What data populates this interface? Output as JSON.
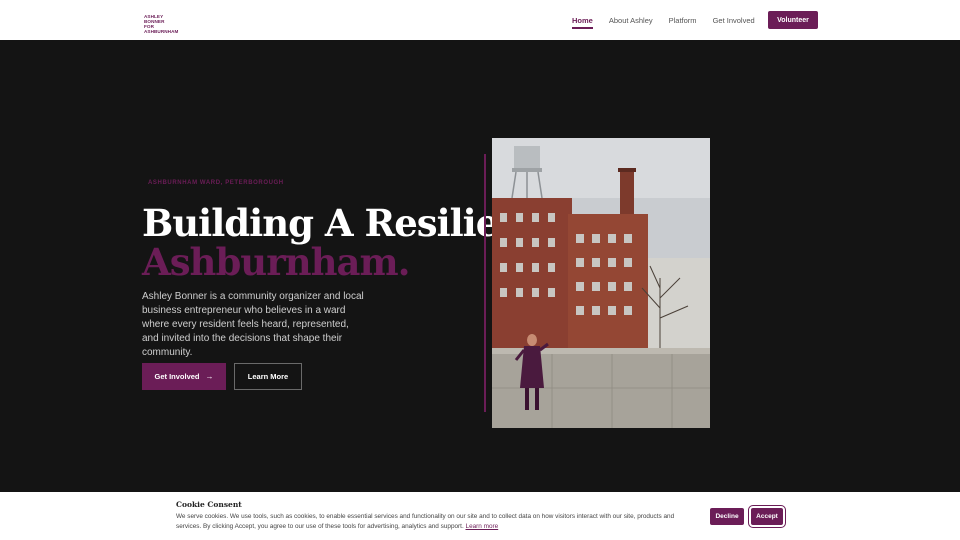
{
  "header": {
    "logo_line1": "ASHLEY BONNER",
    "logo_line2": "FOR ASHBURNHAM",
    "nav": [
      {
        "label": "Home",
        "active": true
      },
      {
        "label": "About Ashley"
      },
      {
        "label": "Platform"
      },
      {
        "label": "Get Involved"
      }
    ],
    "cta_label": "Volunteer"
  },
  "hero": {
    "eyebrow": "ASHBURNHAM WARD, PETERBOROUGH",
    "headline": "Building A Resilient",
    "headline_accent": "Ashburnham.",
    "lede": "Ashley Bonner is a community organizer and local business entrepreneur who believes in a ward where every resident feels heard, represented, and invited into the decisions that shape their community.",
    "primary_button": "Get Involved",
    "primary_button_icon": "arrow-right-icon",
    "secondary_button": "Learn More"
  },
  "cookie": {
    "title": "Cookie Consent",
    "text": "We serve cookies. We use tools, such as cookies, to enable essential services and functionality on our site and to collect data on how visitors interact with our site, products and services. By clicking Accept, you agree to our use of these tools for advertising, analytics and support.",
    "link_label": "Learn more",
    "decline_label": "Decline",
    "accept_label": "Accept"
  },
  "colors": {
    "brand": "#6b1d57",
    "background": "#141414"
  }
}
